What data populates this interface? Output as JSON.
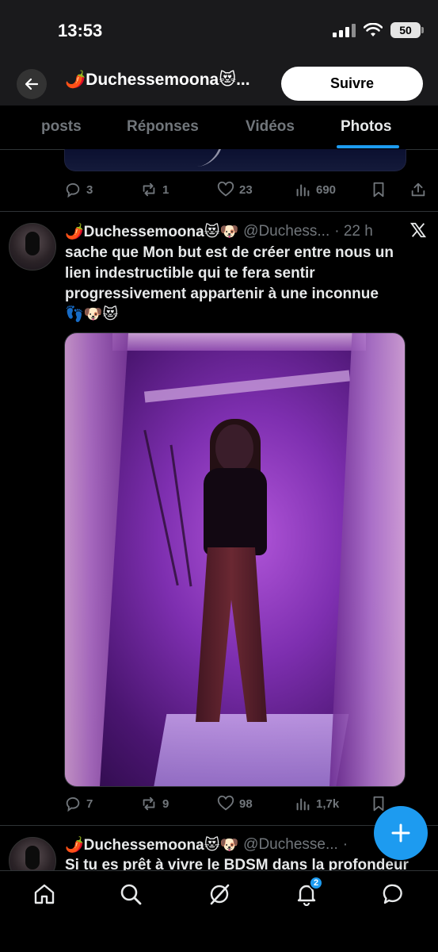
{
  "status": {
    "time": "13:53",
    "battery": "50"
  },
  "header": {
    "title": "🌶️Duchessemoona😻...",
    "follow_label": "Suivre"
  },
  "tabs": [
    {
      "label": "posts",
      "active": false
    },
    {
      "label": "Réponses",
      "active": false
    },
    {
      "label": "Vidéos",
      "active": false
    },
    {
      "label": "Photos",
      "active": true
    }
  ],
  "prev_post": {
    "replies": "3",
    "reposts": "1",
    "likes": "23",
    "views": "690"
  },
  "post": {
    "name": "🌶️Duchessemoona😻🐶",
    "handle": "@Duchess...",
    "time": "· 22 h",
    "text_lines": [
      "sache que Mon but est de créer entre nous un",
      "lien indestructible qui te fera sentir",
      "progressivement appartenir à une inconnue",
      "👣🐶😻"
    ],
    "replies": "7",
    "reposts": "9",
    "likes": "98",
    "views": "1,7k"
  },
  "post3": {
    "name": "🌶️Duchessemoona😻🐶",
    "handle": "@Duchesse...",
    "time": "·",
    "text": "Si tu es prêt à vivre le BDSM dans la profondeur"
  },
  "nav": {
    "notifications_badge": "2"
  },
  "colors": {
    "accent": "#1d9bf0",
    "muted": "#71767b",
    "text": "#e7e9ea"
  }
}
